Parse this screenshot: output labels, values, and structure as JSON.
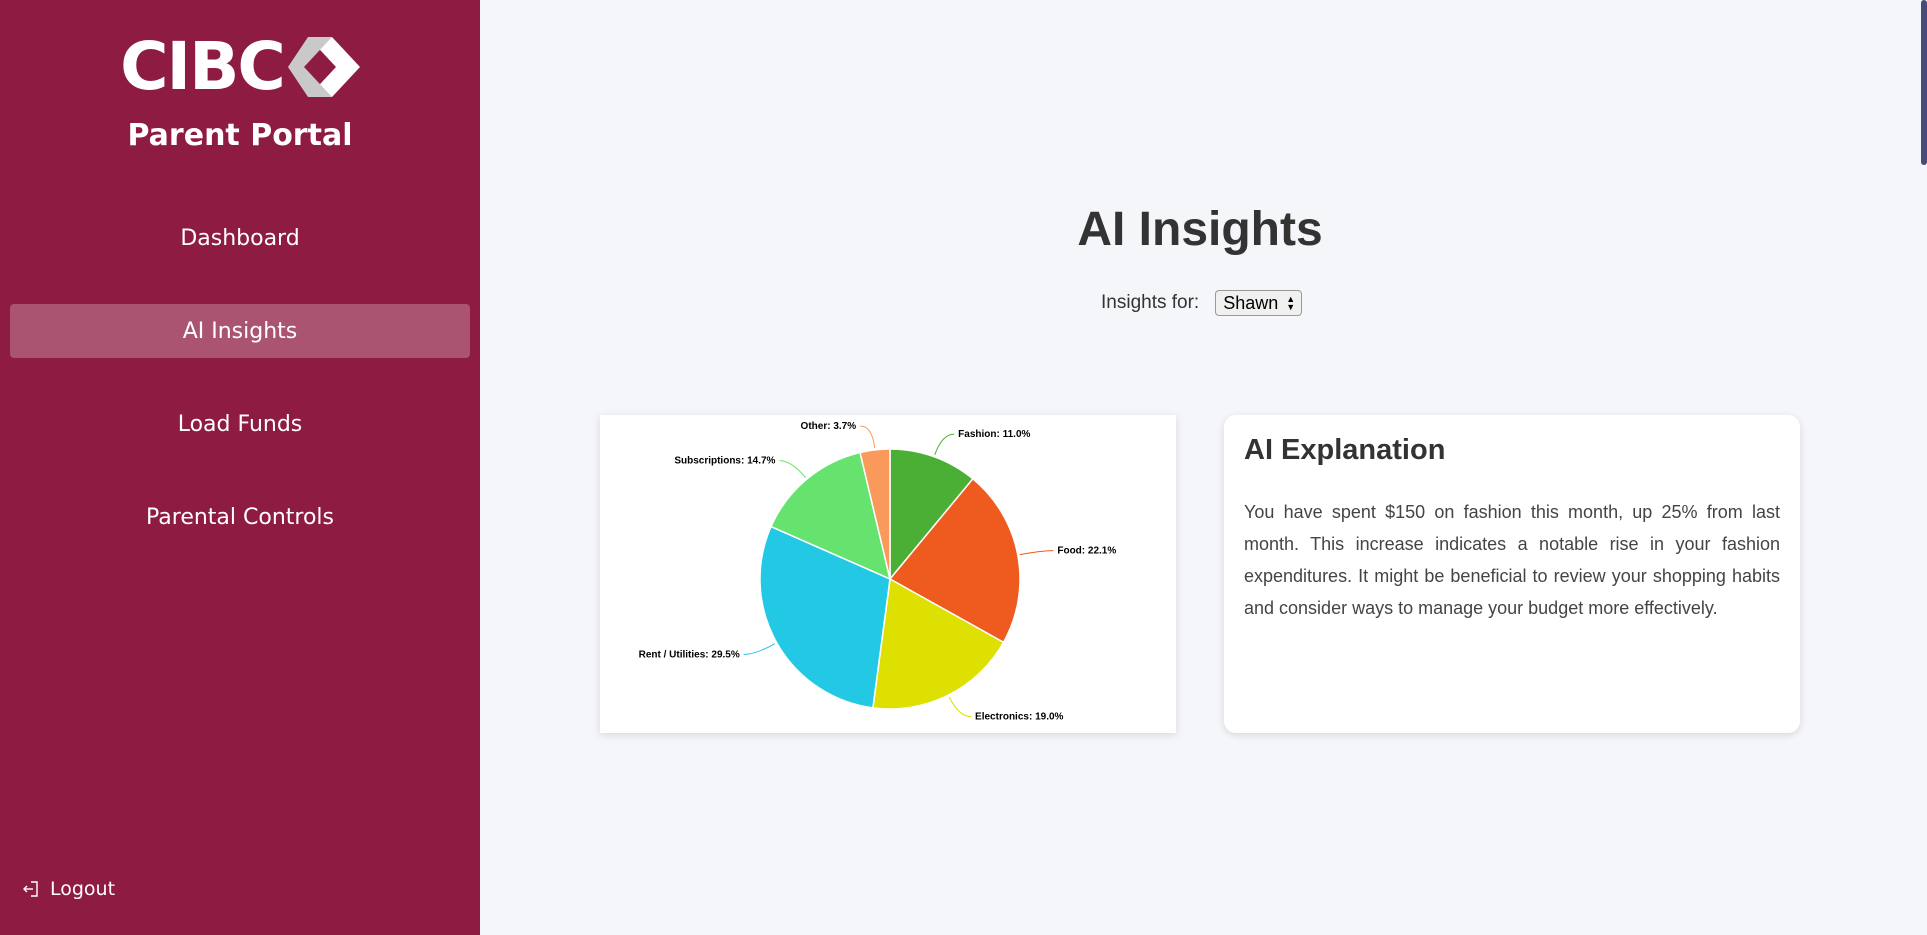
{
  "sidebar": {
    "logo_text": "CIBC",
    "portal_title": "Parent Portal",
    "nav": [
      {
        "label": "Dashboard"
      },
      {
        "label": "AI Insights"
      },
      {
        "label": "Load Funds"
      },
      {
        "label": "Parental Controls"
      }
    ],
    "logout_label": "Logout"
  },
  "main": {
    "title": "AI Insights",
    "insights_for_label": "Insights for:",
    "selected_child": "Shawn"
  },
  "explanation": {
    "title": "AI Explanation",
    "body": "You have spent $150 on fashion this month, up 25% from last month. This increase indicates a notable rise in your fashion expenditures. It might be beneficial to review your shopping habits and consider ways to manage your budget more effectively."
  },
  "colors": {
    "sidebar": "#8e1b42",
    "background": "#f5f6fa"
  },
  "chart_data": {
    "type": "pie",
    "slices": [
      {
        "label": "Fashion",
        "value": 11.0,
        "display": "Fashion: 11.0%",
        "color": "#4caf35"
      },
      {
        "label": "Food",
        "value": 22.1,
        "display": "Food: 22.1%",
        "color": "#ef5a1f"
      },
      {
        "label": "Electronics",
        "value": 19.0,
        "display": "Electronics: 19.0%",
        "color": "#dde000"
      },
      {
        "label": "Rent / Utilities",
        "value": 29.5,
        "display": "Rent / Utilities: 29.5%",
        "color": "#22c8e4"
      },
      {
        "label": "Subscriptions",
        "value": 14.7,
        "display": "Subscriptions: 14.7%",
        "color": "#66e36e"
      },
      {
        "label": "Other",
        "value": 3.7,
        "display": "Other: 3.7%",
        "color": "#f99a5a"
      }
    ]
  }
}
